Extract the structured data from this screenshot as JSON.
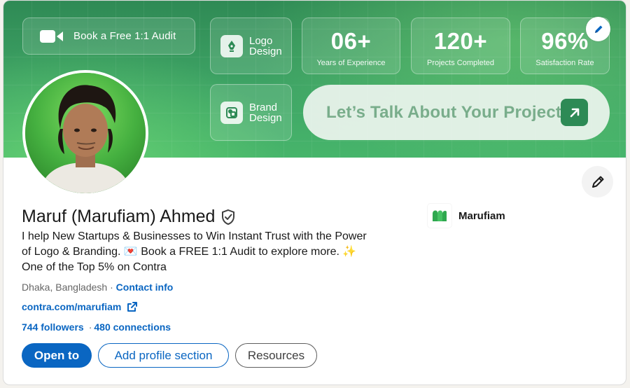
{
  "banner": {
    "audit_label": "Book a Free 1:1 Audit",
    "logo_design_line1": "Logo",
    "logo_design_line2": "Design",
    "brand_design_line1": "Brand",
    "brand_design_line2": "Design",
    "stats": [
      {
        "value": "06+",
        "caption": "Years of Experience"
      },
      {
        "value": "120+",
        "caption": "Projects Completed"
      },
      {
        "value": "96%",
        "caption": "Satisfaction Rate"
      }
    ],
    "cta_label": "Let’s Talk About Your Project",
    "accent_green": "#2d8a55"
  },
  "profile": {
    "name": "Maruf (Marufiam) Ahmed",
    "headline_line1": "I help New Startups & Businesses to Win Instant Trust with the Power",
    "headline_line2a": "of Logo & Branding. 💌  Book a FREE 1:1 Audit to explore more. ✨",
    "headline_line3": "One of the Top 5% on Contra",
    "location": "Dhaka, Bangladesh",
    "location_sep": " · ",
    "contact_info": "Contact info",
    "website": "contra.com/marufiam",
    "followers": "744 followers",
    "connections_sep": "·",
    "connections": "480 connections"
  },
  "actions": {
    "open_to": "Open to",
    "add_section": "Add profile section",
    "resources": "Resources"
  },
  "company": {
    "name": "Marufiam"
  },
  "colors": {
    "link": "#0a66c2",
    "primary_button": "#0a66c2"
  }
}
